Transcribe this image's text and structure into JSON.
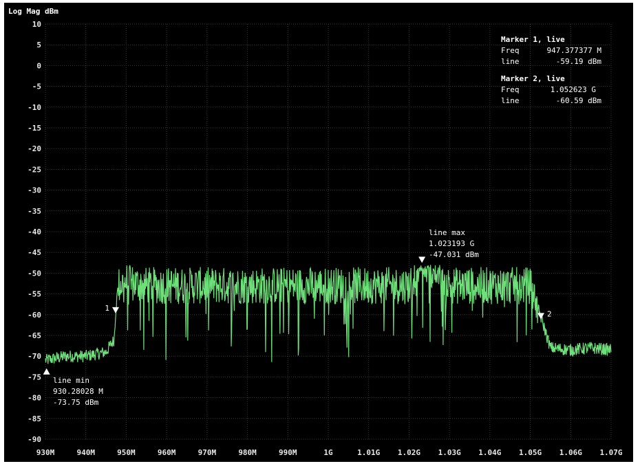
{
  "chart_data": {
    "type": "line",
    "title": "Log Mag dBm",
    "x_unit": "Hz",
    "xlim": [
      930000000,
      1070000000
    ],
    "ylim": [
      -90,
      10
    ],
    "grid": true,
    "y_ticks": [
      "10",
      "5",
      "0",
      "-5",
      "-10",
      "-15",
      "-20",
      "-25",
      "-30",
      "-35",
      "-40",
      "-45",
      "-50",
      "-55",
      "-60",
      "-65",
      "-70",
      "-75",
      "-80",
      "-85",
      "-90"
    ],
    "x_ticks": [
      "930M",
      "940M",
      "950M",
      "960M",
      "970M",
      "980M",
      "990M",
      "1G",
      "1.01G",
      "1.02G",
      "1.03G",
      "1.04G",
      "1.05G",
      "1.06G",
      "1.07G"
    ],
    "series": [
      {
        "color": "#6ee07a",
        "x": [
          930000000,
          935000000,
          940000000,
          945000000,
          947000000,
          947377377,
          948000000,
          950000000,
          955000000,
          960000000,
          970000000,
          980000000,
          990000000,
          1000000000,
          1010000000,
          1020000000,
          1023193000,
          1030000000,
          1040000000,
          1050000000,
          1052623000,
          1055000000,
          1060000000,
          1065000000,
          1070000000
        ],
        "y": [
          -71,
          -70,
          -70,
          -69,
          -66,
          -59.19,
          -53,
          -52,
          -53,
          -53,
          -53,
          -53,
          -53,
          -53,
          -53,
          -53,
          -47.03,
          -53,
          -53,
          -53,
          -60.59,
          -68,
          -68.5,
          -68,
          -68.5
        ]
      }
    ],
    "markers": [
      {
        "label": "1",
        "x": 947377377,
        "y": -59.19,
        "side": "left"
      },
      {
        "label": "2",
        "x": 1052623000,
        "y": -60.59,
        "side": "right"
      },
      {
        "label": "",
        "x": 930280280,
        "y": -73.75,
        "side": "right",
        "direction": "up"
      },
      {
        "label": "",
        "x": 1023193000,
        "y": -47.031,
        "side": "right"
      }
    ],
    "annotations": {
      "line_min": {
        "title": "line min",
        "freq": "930.28028 M",
        "value": "-73.75 dBm"
      },
      "line_max": {
        "title": "line max",
        "freq": "1.023193 G",
        "value": "-47.031 dBm"
      }
    },
    "marker_table": [
      {
        "title": "Marker 1, live",
        "freq_label": "Freq",
        "freq": "947.377377 M",
        "line_label": "line",
        "line": "-59.19 dBm"
      },
      {
        "title": "Marker 2, live",
        "freq_label": "Freq",
        "freq": "1.052623 G",
        "line_label": "line",
        "line": "-60.59 dBm"
      }
    ]
  }
}
